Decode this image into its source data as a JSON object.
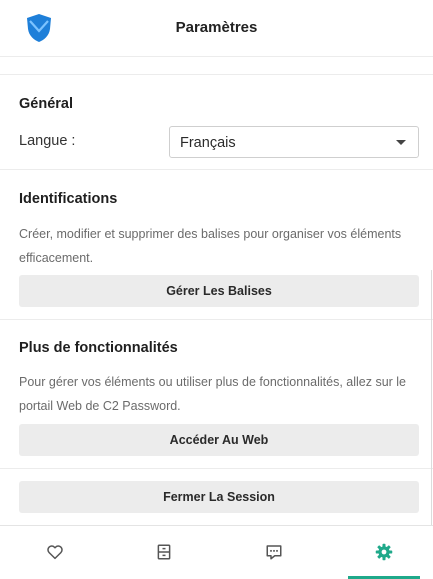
{
  "header": {
    "title": "Paramètres",
    "logo_icon": "shield-icon",
    "accent": "#1e7fd9"
  },
  "general": {
    "title": "Général",
    "language_label": "Langue :",
    "language_value": "Français"
  },
  "identifications": {
    "title": "Identifications",
    "description": "Créer, modifier et supprimer des balises pour organiser vos éléments efficacement.",
    "button_label": "Gérer Les Balises"
  },
  "more_features": {
    "title": "Plus de fonctionnalités",
    "description": "Pour gérer vos éléments ou utiliser plus de fonctionnalités, allez sur le portail Web de C2 Password.",
    "button_label": "Accéder Au Web"
  },
  "session": {
    "button_label": "Fermer La Session"
  },
  "tabbar": {
    "active_color": "#1fa98a",
    "tabs": [
      {
        "icon": "heart-icon",
        "active": false
      },
      {
        "icon": "vault-icon",
        "active": false
      },
      {
        "icon": "chat-icon",
        "active": false
      },
      {
        "icon": "gear-icon",
        "active": true
      }
    ]
  }
}
